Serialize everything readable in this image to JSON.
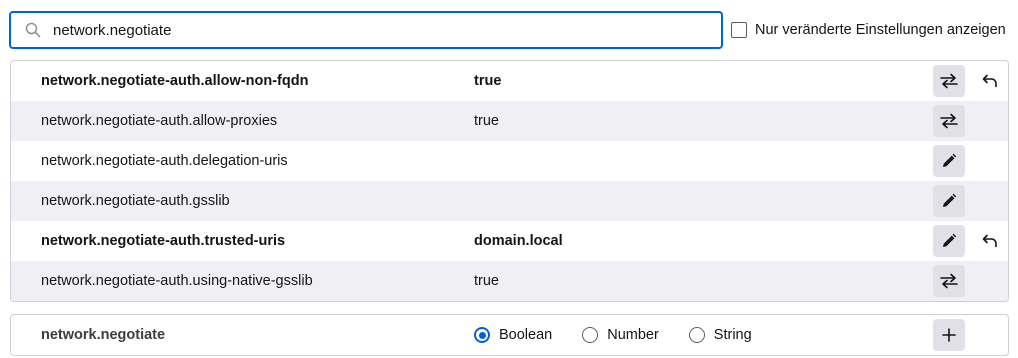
{
  "search": {
    "value": "network.negotiate",
    "icon": "search-icon"
  },
  "modified_only": {
    "label": "Nur veränderte Einstellungen anzeigen",
    "checked": false
  },
  "prefs": [
    {
      "name": "network.negotiate-auth.allow-non-fqdn",
      "value": "true",
      "modified": true,
      "action": "toggle-icon"
    },
    {
      "name": "network.negotiate-auth.allow-proxies",
      "value": "true",
      "modified": false,
      "action": "toggle-icon"
    },
    {
      "name": "network.negotiate-auth.delegation-uris",
      "value": "",
      "modified": false,
      "action": "edit-icon"
    },
    {
      "name": "network.negotiate-auth.gsslib",
      "value": "",
      "modified": false,
      "action": "edit-icon"
    },
    {
      "name": "network.negotiate-auth.trusted-uris",
      "value": "domain.local",
      "modified": true,
      "action": "edit-icon"
    },
    {
      "name": "network.negotiate-auth.using-native-gsslib",
      "value": "true",
      "modified": false,
      "action": "toggle-icon"
    }
  ],
  "add_pref": {
    "name": "network.negotiate",
    "types": [
      {
        "label": "Boolean",
        "checked": true
      },
      {
        "label": "Number",
        "checked": false
      },
      {
        "label": "String",
        "checked": false
      }
    ],
    "add_icon": "plus-icon"
  },
  "colors": {
    "accent": "#0061e0",
    "alt_row": "#f0f0f4",
    "button_bg": "#e0e0e6"
  }
}
